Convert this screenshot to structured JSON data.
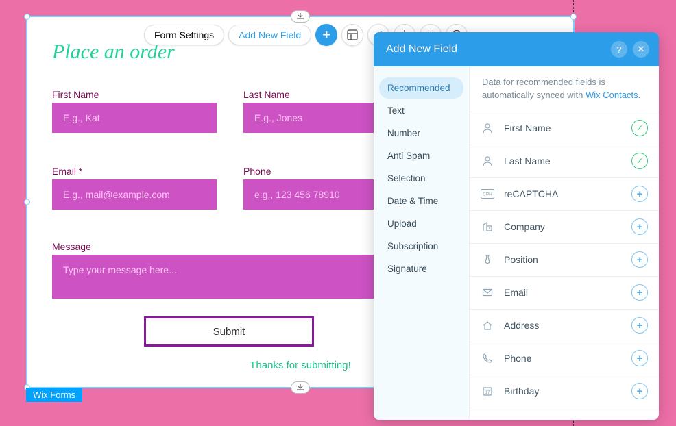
{
  "toolbar": {
    "form_settings": "Form Settings",
    "add_new_field": "Add New Field"
  },
  "form": {
    "title": "Place an order",
    "first_name_label": "First Name",
    "first_name_placeholder": "E.g., Kat",
    "last_name_label": "Last Name",
    "last_name_placeholder": "E.g., Jones",
    "email_label": "Email *",
    "email_placeholder": "E.g., mail@example.com",
    "phone_label": "Phone",
    "phone_placeholder": "e.g., 123 456 78910",
    "message_label": "Message",
    "message_placeholder": "Type your message here...",
    "submit": "Submit",
    "thanks": "Thanks for submitting!",
    "tag": "Wix Forms"
  },
  "panel": {
    "title": "Add New Field",
    "help": "?",
    "close": "✕",
    "info_pre": "Data for recommended fields is automatically synced with ",
    "info_link": "Wix Contacts",
    "info_post": ".",
    "categories": [
      "Recommended",
      "Text",
      "Number",
      "Anti Spam",
      "Selection",
      "Date & Time",
      "Upload",
      "Subscription",
      "Signature"
    ],
    "fields": [
      {
        "label": "First Name",
        "icon": "user",
        "state": "check"
      },
      {
        "label": "Last Name",
        "icon": "user",
        "state": "check"
      },
      {
        "label": "reCAPTCHA",
        "icon": "cph",
        "state": "plus"
      },
      {
        "label": "Company",
        "icon": "building",
        "state": "plus"
      },
      {
        "label": "Position",
        "icon": "tie",
        "state": "plus"
      },
      {
        "label": "Email",
        "icon": "mail",
        "state": "plus"
      },
      {
        "label": "Address",
        "icon": "home",
        "state": "plus"
      },
      {
        "label": "Phone",
        "icon": "phone",
        "state": "plus"
      },
      {
        "label": "Birthday",
        "icon": "calendar",
        "state": "plus"
      }
    ]
  }
}
